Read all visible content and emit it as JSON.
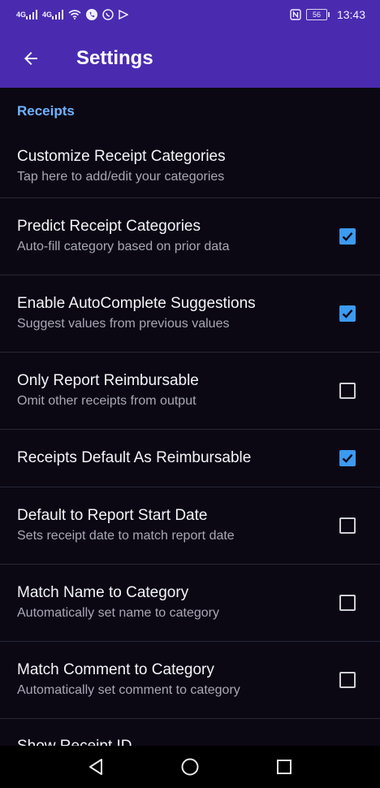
{
  "status": {
    "net1": "4G",
    "net2": "4G",
    "battery": "56",
    "time": "13:43"
  },
  "header": {
    "title": "Settings"
  },
  "section": {
    "title": "Receipts"
  },
  "prefs": [
    {
      "title": "Customize Receipt Categories",
      "subtitle": "Tap here to add/edit your categories"
    },
    {
      "title": "Predict Receipt Categories",
      "subtitle": "Auto-fill category based on prior data",
      "checked": true
    },
    {
      "title": "Enable AutoComplete Suggestions",
      "subtitle": "Suggest values from previous values",
      "checked": true
    },
    {
      "title": "Only Report Reimbursable",
      "subtitle": "Omit other receipts from output",
      "checked": false
    },
    {
      "title": "Receipts Default As Reimbursable",
      "checked": true
    },
    {
      "title": "Default to Report Start Date",
      "subtitle": "Sets receipt date to match report date",
      "checked": false
    },
    {
      "title": "Match Name to Category",
      "subtitle": "Automatically set name to category",
      "checked": false
    },
    {
      "title": "Match Comment to Category",
      "subtitle": "Automatically set comment to category",
      "checked": false
    },
    {
      "title": "Show Receipt ID"
    }
  ],
  "colors": {
    "primary": "#4a2bb0",
    "accent": "#3c9af0",
    "section": "#6fb2ff",
    "background": "#0b0814"
  },
  "icons": {
    "back": "arrow-left",
    "nav_back": "triangle",
    "nav_home": "circle",
    "nav_recents": "square"
  }
}
